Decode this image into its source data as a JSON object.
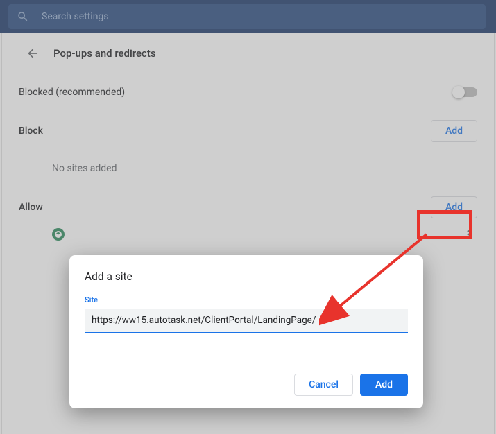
{
  "search": {
    "placeholder": "Search settings"
  },
  "header": {
    "title": "Pop-ups and redirects"
  },
  "blocked": {
    "label": "Blocked (recommended)",
    "enabled": false
  },
  "block": {
    "label": "Block",
    "add_label": "Add",
    "empty_text": "No sites added"
  },
  "allow": {
    "label": "Allow",
    "add_label": "Add"
  },
  "dialog": {
    "title": "Add a site",
    "field_label": "Site",
    "field_value": "https://ww15.autotask.net/ClientPortal/LandingPage/",
    "cancel_label": "Cancel",
    "add_label": "Add"
  }
}
